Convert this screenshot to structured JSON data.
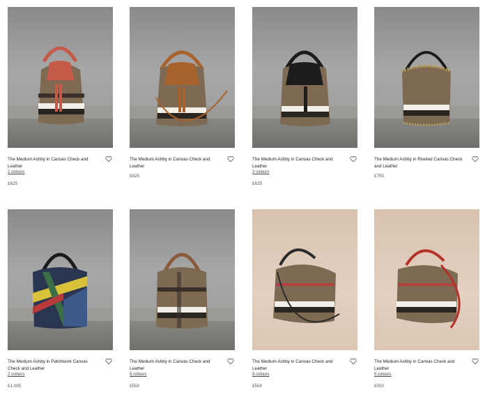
{
  "products": [
    {
      "name": "The Medium Ashby in Canvas Check and Leather",
      "colours": "2 colours",
      "price": "£625",
      "trim": "#c55a48",
      "backdrop": "grey"
    },
    {
      "name": "The Medium Ashby in Canvas Check and Leather",
      "colours": "",
      "price": "£625",
      "trim": "#a8632c",
      "backdrop": "grey"
    },
    {
      "name": "The Medium Ashby in Canvas Check and Leather",
      "colours": "2 colours",
      "price": "£625",
      "trim": "#1c1c1c",
      "backdrop": "grey"
    },
    {
      "name": "The Medium Ashby in Riveted Canvas Check and Leather",
      "colours": "",
      "price": "£750",
      "trim": "#1c1c1c",
      "backdrop": "grey"
    },
    {
      "name": "The Medium Ashby in Patchwork Canvas Check and Leather",
      "colours": "2 colours",
      "price": "£1,095",
      "trim": "#1c1c1c",
      "backdrop": "grey"
    },
    {
      "name": "The Medium Ashby in Canvas Check and Leather",
      "colours": "5 colours",
      "price": "£550",
      "trim": "#8a5a3c",
      "backdrop": "grey"
    },
    {
      "name": "The Medium Ashby in Canvas Check and Leather",
      "colours": "5 colours",
      "price": "£550",
      "trim": "#2a2a2a",
      "backdrop": "beige"
    },
    {
      "name": "The Medium Ashby in Canvas Check and Leather",
      "colours": "5 colours",
      "price": "£550",
      "trim": "#b3322a",
      "backdrop": "beige"
    }
  ],
  "icons": {
    "wishlist": "heart-outline-icon"
  }
}
